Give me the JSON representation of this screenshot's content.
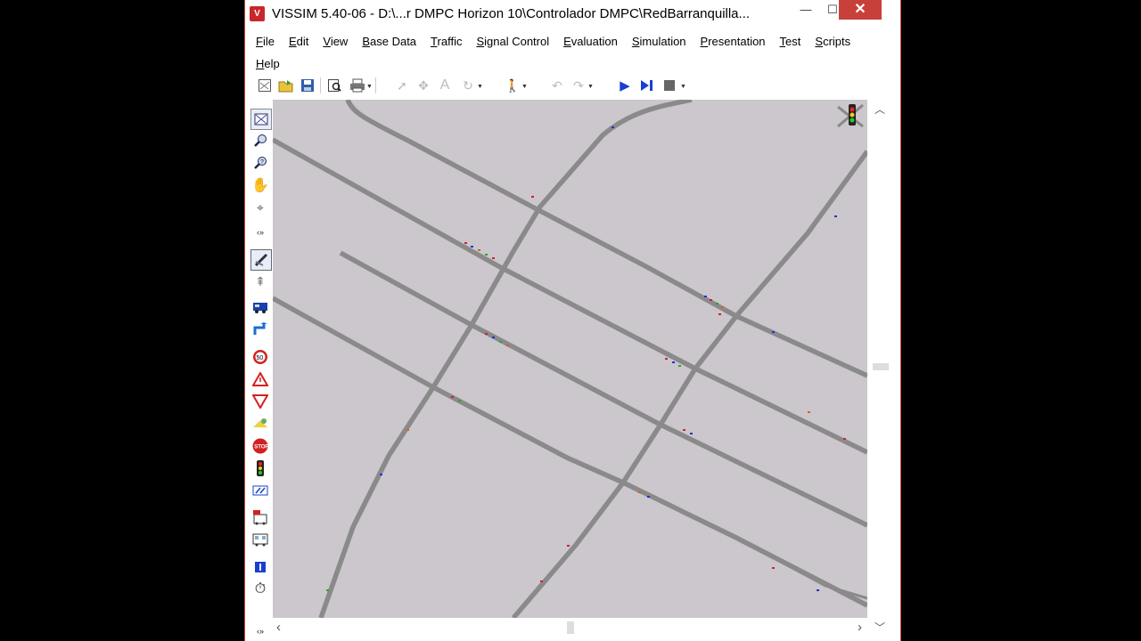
{
  "window": {
    "title": "VISSIM 5.40-06 - D:\\...r DMPC Horizon 10\\Controlador DMPC\\RedBarranquilla...",
    "app_icon": "vissim-logo-icon",
    "controls": {
      "minimize": "—",
      "maximize": "☐",
      "close": "✕"
    }
  },
  "menu": {
    "row1": [
      {
        "label": "File",
        "u": "F",
        "rest": "ile"
      },
      {
        "label": "Edit",
        "u": "E",
        "rest": "dit"
      },
      {
        "label": "View",
        "u": "V",
        "rest": "iew"
      },
      {
        "label": "Base Data",
        "u": "B",
        "rest": "ase Data"
      },
      {
        "label": "Traffic",
        "u": "T",
        "rest": "raffic"
      },
      {
        "label": "Signal Control",
        "u": "S",
        "rest": "ignal Control"
      },
      {
        "label": "Evaluation",
        "u": "E",
        "rest": "valuation"
      },
      {
        "label": "Simulation",
        "u": "S",
        "rest": "imulation"
      },
      {
        "label": "Presentation",
        "u": "P",
        "rest": "resentation"
      },
      {
        "label": "Test",
        "u": "T",
        "rest": "est"
      },
      {
        "label": "Scripts",
        "u": "S",
        "rest": "cripts"
      }
    ],
    "row2": [
      {
        "label": "Help",
        "u": "H",
        "rest": "elp"
      }
    ]
  },
  "toolbar": {
    "icons": [
      "new-network-icon",
      "open-file-icon",
      "save-icon",
      "print-preview-icon",
      "print-icon",
      "select-pointer-icon",
      "multi-select-icon",
      "label-tool-icon",
      "rotate-icon",
      "pedestrian-icon",
      "undo-icon",
      "redo-icon",
      "run-simulation-icon",
      "single-step-icon",
      "stop-simulation-icon"
    ]
  },
  "left_toolbar": {
    "icons": [
      "zoom-extents-icon",
      "zoom-in-icon",
      "zoom-out-icon",
      "pan-hand-icon",
      "rotate-view-icon",
      "collapse-icon",
      "links-mode-icon",
      "connector-mode-icon",
      "vehicle-inputs-icon",
      "routing-icon",
      "speed-limit-icon",
      "priority-rule-icon",
      "conflict-area-icon",
      "detector-icon",
      "stop-sign-icon",
      "signal-head-icon",
      "data-collection-icon",
      "transit-stop-icon",
      "transit-line-icon",
      "node-icon",
      "timer-icon",
      "expand-icon"
    ]
  },
  "canvas": {
    "background": "#cbc7cc",
    "road_color": "#8a8a8a",
    "signal_indicator": "traffic-light-icon"
  },
  "scrollbars": {
    "up_arrow": "︿",
    "down_arrow": "﹀",
    "left_arrow": "‹",
    "right_arrow": "›"
  }
}
